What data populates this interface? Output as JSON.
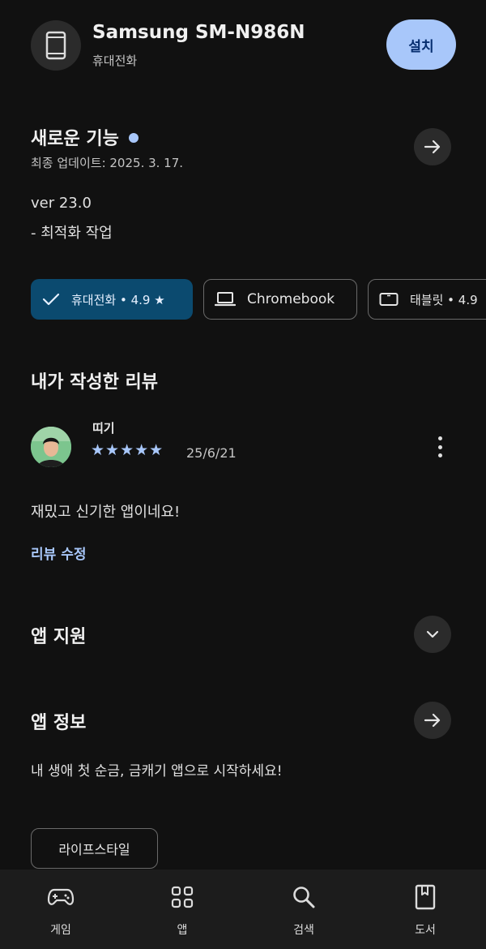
{
  "header": {
    "device_name": "Samsung SM-N986N",
    "device_type": "휴대전화",
    "install_label": "설치"
  },
  "whats_new": {
    "title": "새로운 기능",
    "last_updated": "최종 업데이트: 2025. 3. 17.",
    "version": "ver 23.0",
    "note": "- 최적화 작업"
  },
  "device_chips": [
    {
      "label": "휴대전화 • 4.9 ★",
      "icon": "check-icon",
      "selected": true
    },
    {
      "label": "Chromebook",
      "icon": "laptop-icon",
      "selected": false
    },
    {
      "label": "태블릿 • 4.9",
      "icon": "tablet-icon",
      "selected": false
    }
  ],
  "my_review": {
    "title": "내가 작성한 리뷰",
    "reviewer": "띠기",
    "rating": 5,
    "stars": "★★★★★",
    "date": "25/6/21",
    "text": "재밌고 신기한 앱이네요!",
    "edit_label": "리뷰 수정"
  },
  "app_support": {
    "title": "앱 지원"
  },
  "app_info": {
    "title": "앱 정보",
    "description": "내 생애 첫 순금, 금캐기 앱으로 시작하세요!",
    "category": "라이프스타일"
  },
  "bottom_nav": [
    {
      "label": "게임",
      "icon": "gamepad-icon"
    },
    {
      "label": "앱",
      "icon": "apps-grid-icon"
    },
    {
      "label": "검색",
      "icon": "search-icon"
    },
    {
      "label": "도서",
      "icon": "book-icon"
    }
  ],
  "colors": {
    "background": "#111111",
    "accent": "#a8c7fa",
    "selected_chip": "#0b4a6f",
    "nav_background": "#1c1c1c"
  }
}
